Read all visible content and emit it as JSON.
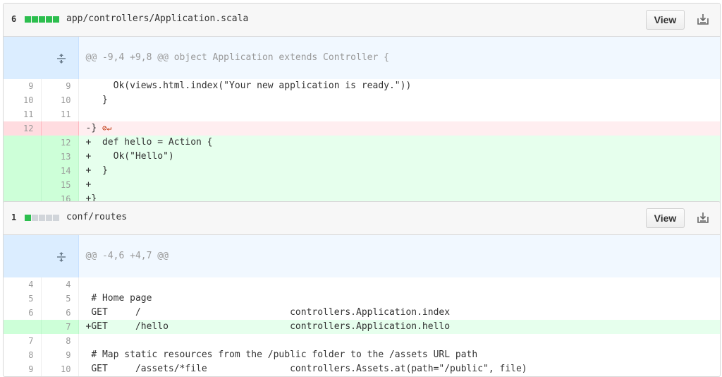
{
  "files": [
    {
      "count": "6",
      "name": "app/controllers/Application.scala",
      "view_label": "View",
      "hunk": "@@ -9,4 +9,8 @@ object Application extends Controller {",
      "lines": [
        {
          "type": "ctx",
          "old": "9",
          "new": "9",
          "text": "     Ok(views.html.index(\"Your new application is ready.\"))"
        },
        {
          "type": "ctx",
          "old": "10",
          "new": "10",
          "text": "   }"
        },
        {
          "type": "ctx",
          "old": "11",
          "new": "11",
          "text": ""
        },
        {
          "type": "del",
          "old": "12",
          "new": "",
          "text": "-}"
        },
        {
          "type": "add",
          "old": "",
          "new": "12",
          "text": "+  def hello = Action {"
        },
        {
          "type": "add",
          "old": "",
          "new": "13",
          "text": "+    Ok(\"Hello\")"
        },
        {
          "type": "add",
          "old": "",
          "new": "14",
          "text": "+  }"
        },
        {
          "type": "add",
          "old": "",
          "new": "15",
          "text": "+"
        },
        {
          "type": "add",
          "old": "",
          "new": "16",
          "text": "+}"
        }
      ]
    },
    {
      "count": "1",
      "name": "conf/routes",
      "view_label": "View",
      "hunk": "@@ -4,6 +4,7 @@",
      "lines": [
        {
          "type": "ctx",
          "old": "4",
          "new": "4",
          "text": ""
        },
        {
          "type": "ctx",
          "old": "5",
          "new": "5",
          "text": " # Home page"
        },
        {
          "type": "ctx",
          "old": "6",
          "new": "6",
          "text": " GET     /                           controllers.Application.index"
        },
        {
          "type": "add",
          "old": "",
          "new": "7",
          "text": "+GET     /hello                      controllers.Application.hello"
        },
        {
          "type": "ctx",
          "old": "7",
          "new": "8",
          "text": ""
        },
        {
          "type": "ctx",
          "old": "8",
          "new": "9",
          "text": " # Map static resources from the /public folder to the /assets URL path"
        },
        {
          "type": "ctx",
          "old": "9",
          "new": "10",
          "text": " GET     /assets/*file               controllers.Assets.at(path=\"/public\", file)"
        }
      ]
    }
  ],
  "colors": {
    "added": "#e6ffed",
    "deleted": "#ffeef0",
    "hunk": "#f1f8ff",
    "stat_green": "#2cbe4e"
  },
  "icons": {
    "expand": "expand-icon",
    "download": "download-icon",
    "no_newline": "no-newline-icon"
  }
}
